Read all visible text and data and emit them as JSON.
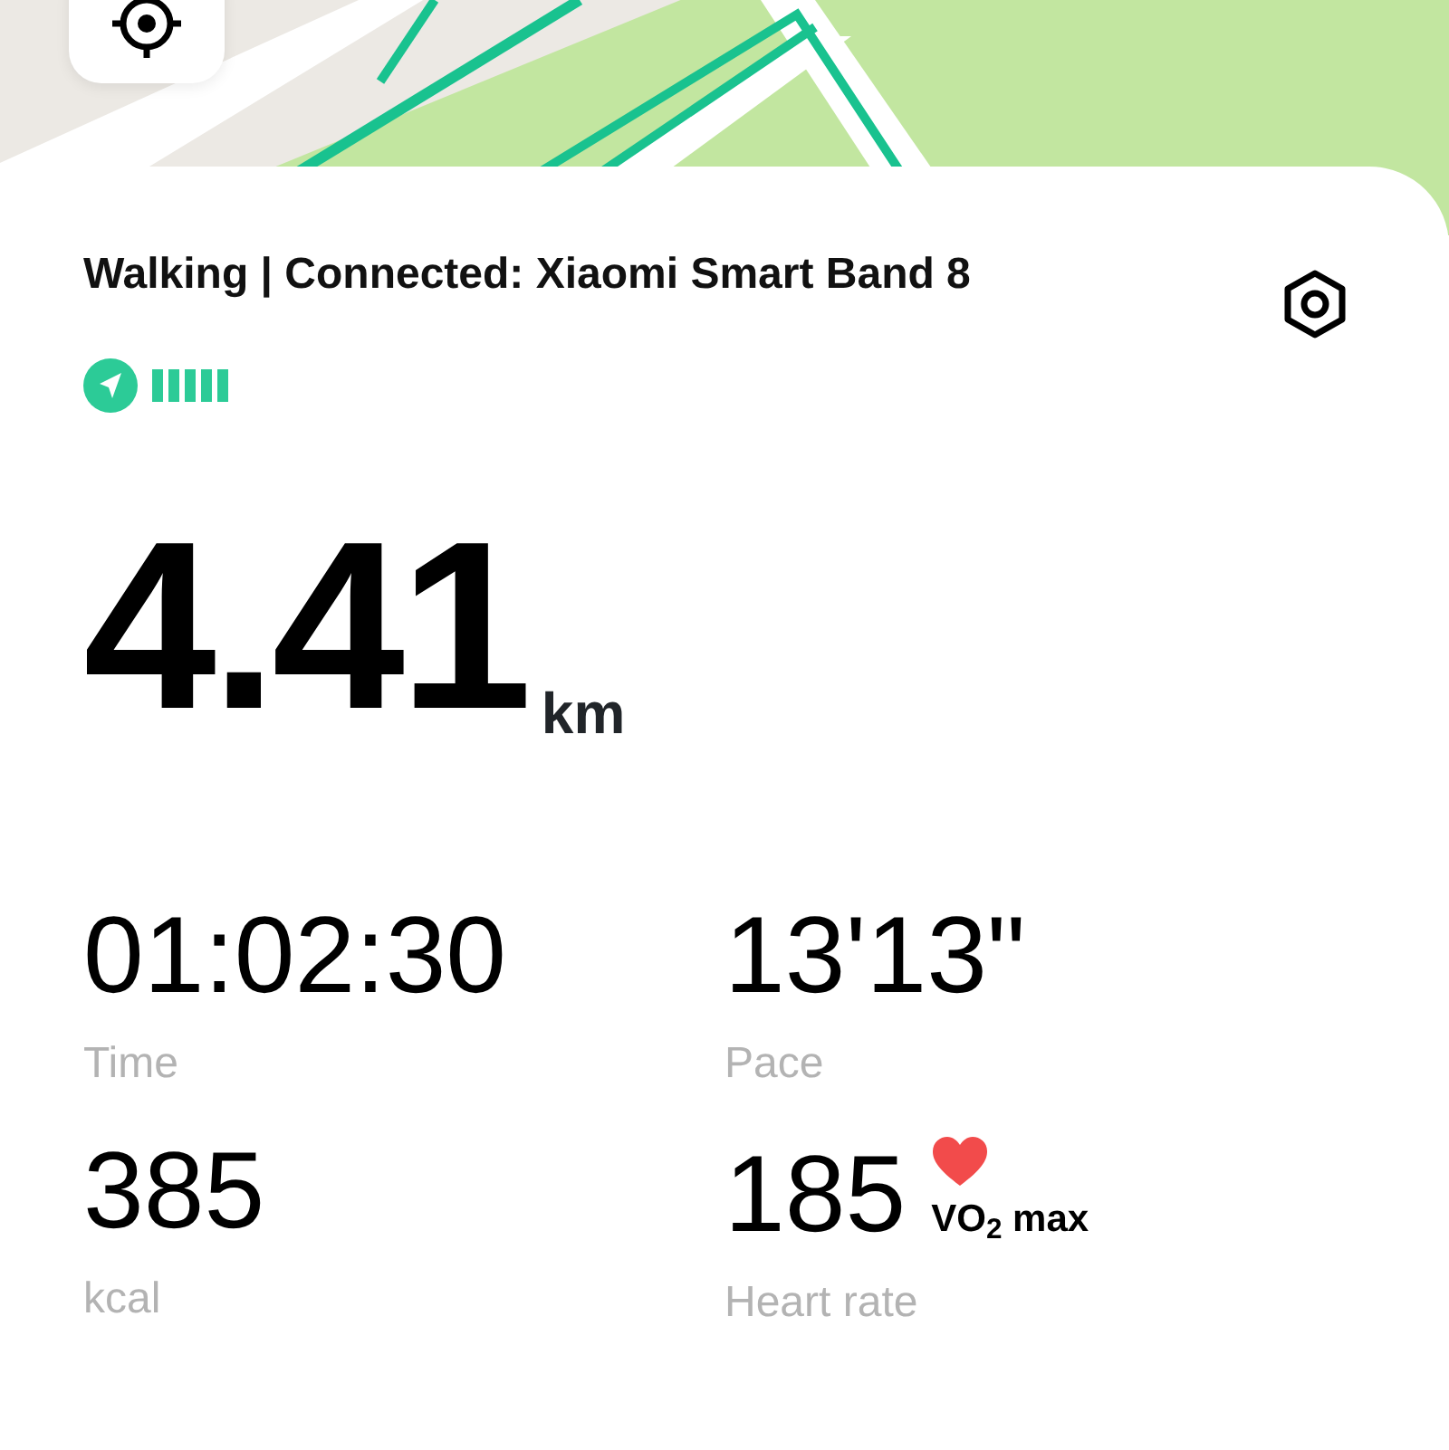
{
  "header": {
    "title": "Walking | Connected: Xiaomi Smart Band 8"
  },
  "distance": {
    "value": "4.41",
    "unit": "km"
  },
  "stats": [
    {
      "value": "01:02:30",
      "label": "Time"
    },
    {
      "value": "13'13\"",
      "label": "Pace"
    },
    {
      "value": "385",
      "label": "kcal"
    },
    {
      "value": "185",
      "label": "Heart rate",
      "badge": "VO$_{2}$ max"
    }
  ]
}
